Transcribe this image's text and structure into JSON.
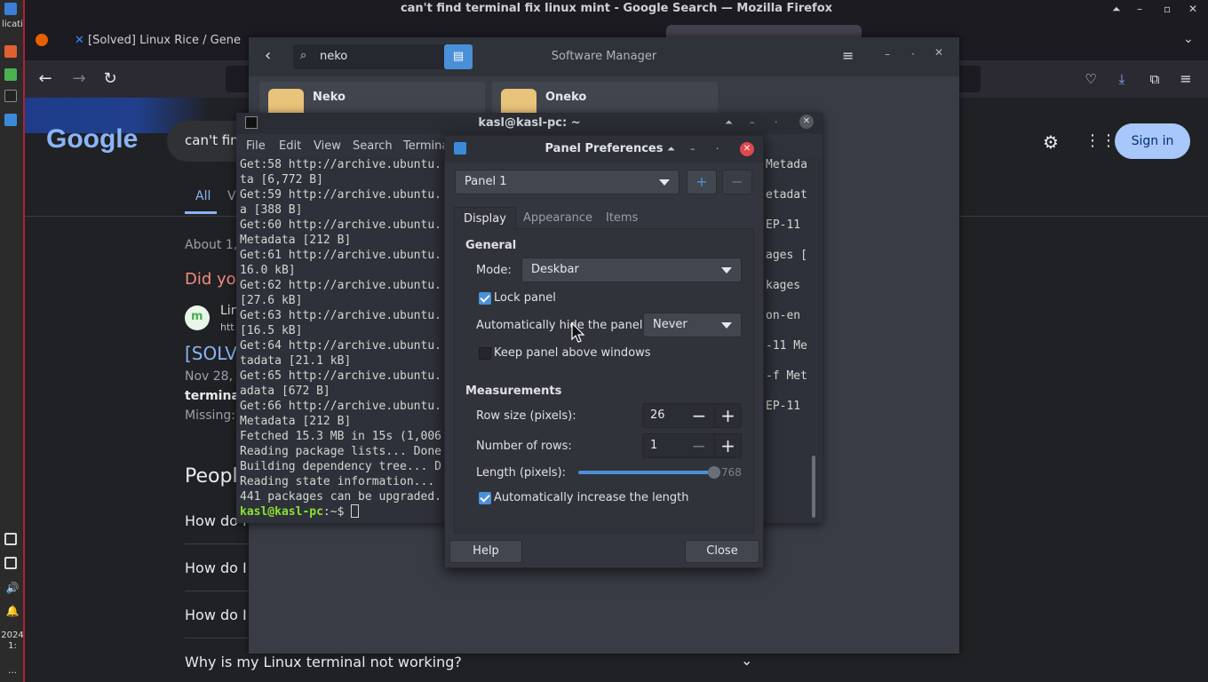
{
  "left_panel": {
    "label_top": "licati",
    "date": "2024",
    "time_short": "1:"
  },
  "firefox": {
    "window_title": "can't find terminal fix linux mint - Google Search — Mozilla Firefox",
    "tab1_label": "[Solved] Linux Rice / Gene"
  },
  "google": {
    "logo": "Google",
    "search_query": "can't fin",
    "sign_in": "Sign in",
    "tab_all": "All",
    "tab_v": "V",
    "about": "About 1,4",
    "did_you": "Did you",
    "result_site": "Lin",
    "result_url": "htt",
    "result_title": "[SOLV",
    "result_date": "Nov 28, 2",
    "result_bold": "terminal",
    "result_missing": "Missing: f",
    "people_heading": "Peopl",
    "q1": "How do I",
    "q2": "How do I r",
    "q3": "How do I e",
    "q4": "Why is my Linux terminal not working?"
  },
  "software_manager": {
    "title": "Software Manager",
    "search_value": "neko",
    "result1": "Neko",
    "result2": "Oneko"
  },
  "terminal": {
    "title": "kasl@kasl-pc: ~",
    "menu": [
      "File",
      "Edit",
      "View",
      "Search",
      "Termina"
    ],
    "lines": [
      "Get:58 http://archive.ubuntu.",
      "ta [6,772 B]",
      "Get:59 http://archive.ubuntu.",
      "a [388 B]",
      "Get:60 http://archive.ubuntu.",
      "Metadata [212 B]",
      "Get:61 http://archive.ubuntu.",
      "16.0 kB]",
      "Get:62 http://archive.ubuntu.",
      "[27.6 kB]",
      "Get:63 http://archive.ubuntu.",
      "[16.5 kB]",
      "Get:64 http://archive.ubuntu.",
      "tadata [21.1 kB]",
      "Get:65 http://archive.ubuntu.",
      "adata [672 B]",
      "Get:66 http://archive.ubuntu.",
      "Metadata [212 B]",
      "Fetched 15.3 MB in 15s (1,006",
      "Reading package lists... Done",
      "Building dependency tree... D",
      "Reading state information...",
      "441 packages can be upgraded."
    ],
    "right_lines": [
      "Metada",
      "etadat",
      "EP-11",
      "ages [",
      "kages",
      "on-en",
      "-11 Me",
      "-f Met",
      "EP-11"
    ],
    "prompt_user": "kasl@kasl-pc",
    "prompt_rest": ":~$ "
  },
  "panel_prefs": {
    "title": "Panel Preferences",
    "panel_select": "Panel 1",
    "tabs": [
      "Display",
      "Appearance",
      "Items"
    ],
    "general_heading": "General",
    "mode_label": "Mode:",
    "mode_value": "Deskbar",
    "lock_panel": "Lock panel",
    "lock_panel_checked": true,
    "autohide_label": "Automatically hide the panel:",
    "autohide_value": "Never",
    "keep_above": "Keep panel above windows",
    "keep_above_checked": false,
    "measurements_heading": "Measurements",
    "row_size_label": "Row size (pixels):",
    "row_size_value": "26",
    "rows_label": "Number of rows:",
    "rows_value": "1",
    "length_label": "Length (pixels):",
    "length_value": "768",
    "length_fraction": 0.98,
    "auto_length": "Automatically increase the length",
    "auto_length_checked": true,
    "help_button": "Help",
    "close_button": "Close"
  },
  "colors": {
    "accent": "#4a90d9",
    "panel_border": "#b02030",
    "google_blue": "#8ab4f8",
    "did_you_red": "#f28b82"
  }
}
